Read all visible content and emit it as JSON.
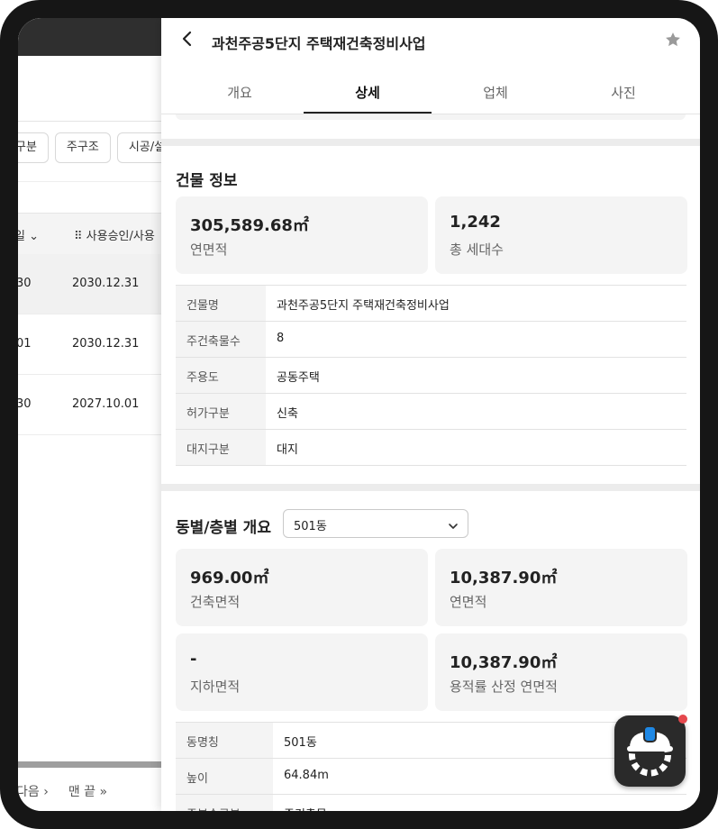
{
  "background": {
    "filter_chips": [
      "구분",
      "주구조",
      "시공/설치"
    ],
    "table_headers": [
      "일",
      "사용승인/사용"
    ],
    "rows": [
      {
        "a": "30",
        "b": "2030.12.31"
      },
      {
        "a": "01",
        "b": "2030.12.31"
      },
      {
        "a": "30",
        "b": "2027.10.01"
      }
    ],
    "pager": {
      "next": "다음",
      "last": "맨 끝"
    }
  },
  "panel": {
    "title": "과천주공5단지 주택재건축정비사업",
    "tabs": [
      "개요",
      "상세",
      "업체",
      "사진"
    ],
    "active_tab": "상세",
    "building_info": {
      "title": "건물 정보",
      "stats": [
        {
          "value": "305,589.68㎡",
          "label": "연면적"
        },
        {
          "value": "1,242",
          "label": "총 세대수"
        }
      ],
      "rows": [
        {
          "key": "건물명",
          "value": "과천주공5단지 주택재건축정비사업"
        },
        {
          "key": "주건축물수",
          "value": "8"
        },
        {
          "key": "주용도",
          "value": "공동주택"
        },
        {
          "key": "허가구분",
          "value": "신축"
        },
        {
          "key": "대지구분",
          "value": "대지"
        }
      ]
    },
    "floor_overview": {
      "title": "동별/층별 개요",
      "selected_building": "501동",
      "stats": [
        {
          "value": "969.00㎡",
          "label": "건축면적"
        },
        {
          "value": "10,387.90㎡",
          "label": "연면적"
        },
        {
          "value": "-",
          "label": "지하면적"
        },
        {
          "value": "10,387.90㎡",
          "label": "용적률 산정 연면적"
        }
      ],
      "rows": [
        {
          "key": "동명칭",
          "value": "501동"
        },
        {
          "key": "높이",
          "value": "64.84m"
        },
        {
          "key": "주부속구분",
          "value": "주건축물"
        }
      ]
    }
  },
  "colors": {
    "accent": "#222222",
    "card_bg": "#f4f4f4",
    "notification_dot": "#e5484d",
    "helmet_blue": "#1e88e5"
  }
}
